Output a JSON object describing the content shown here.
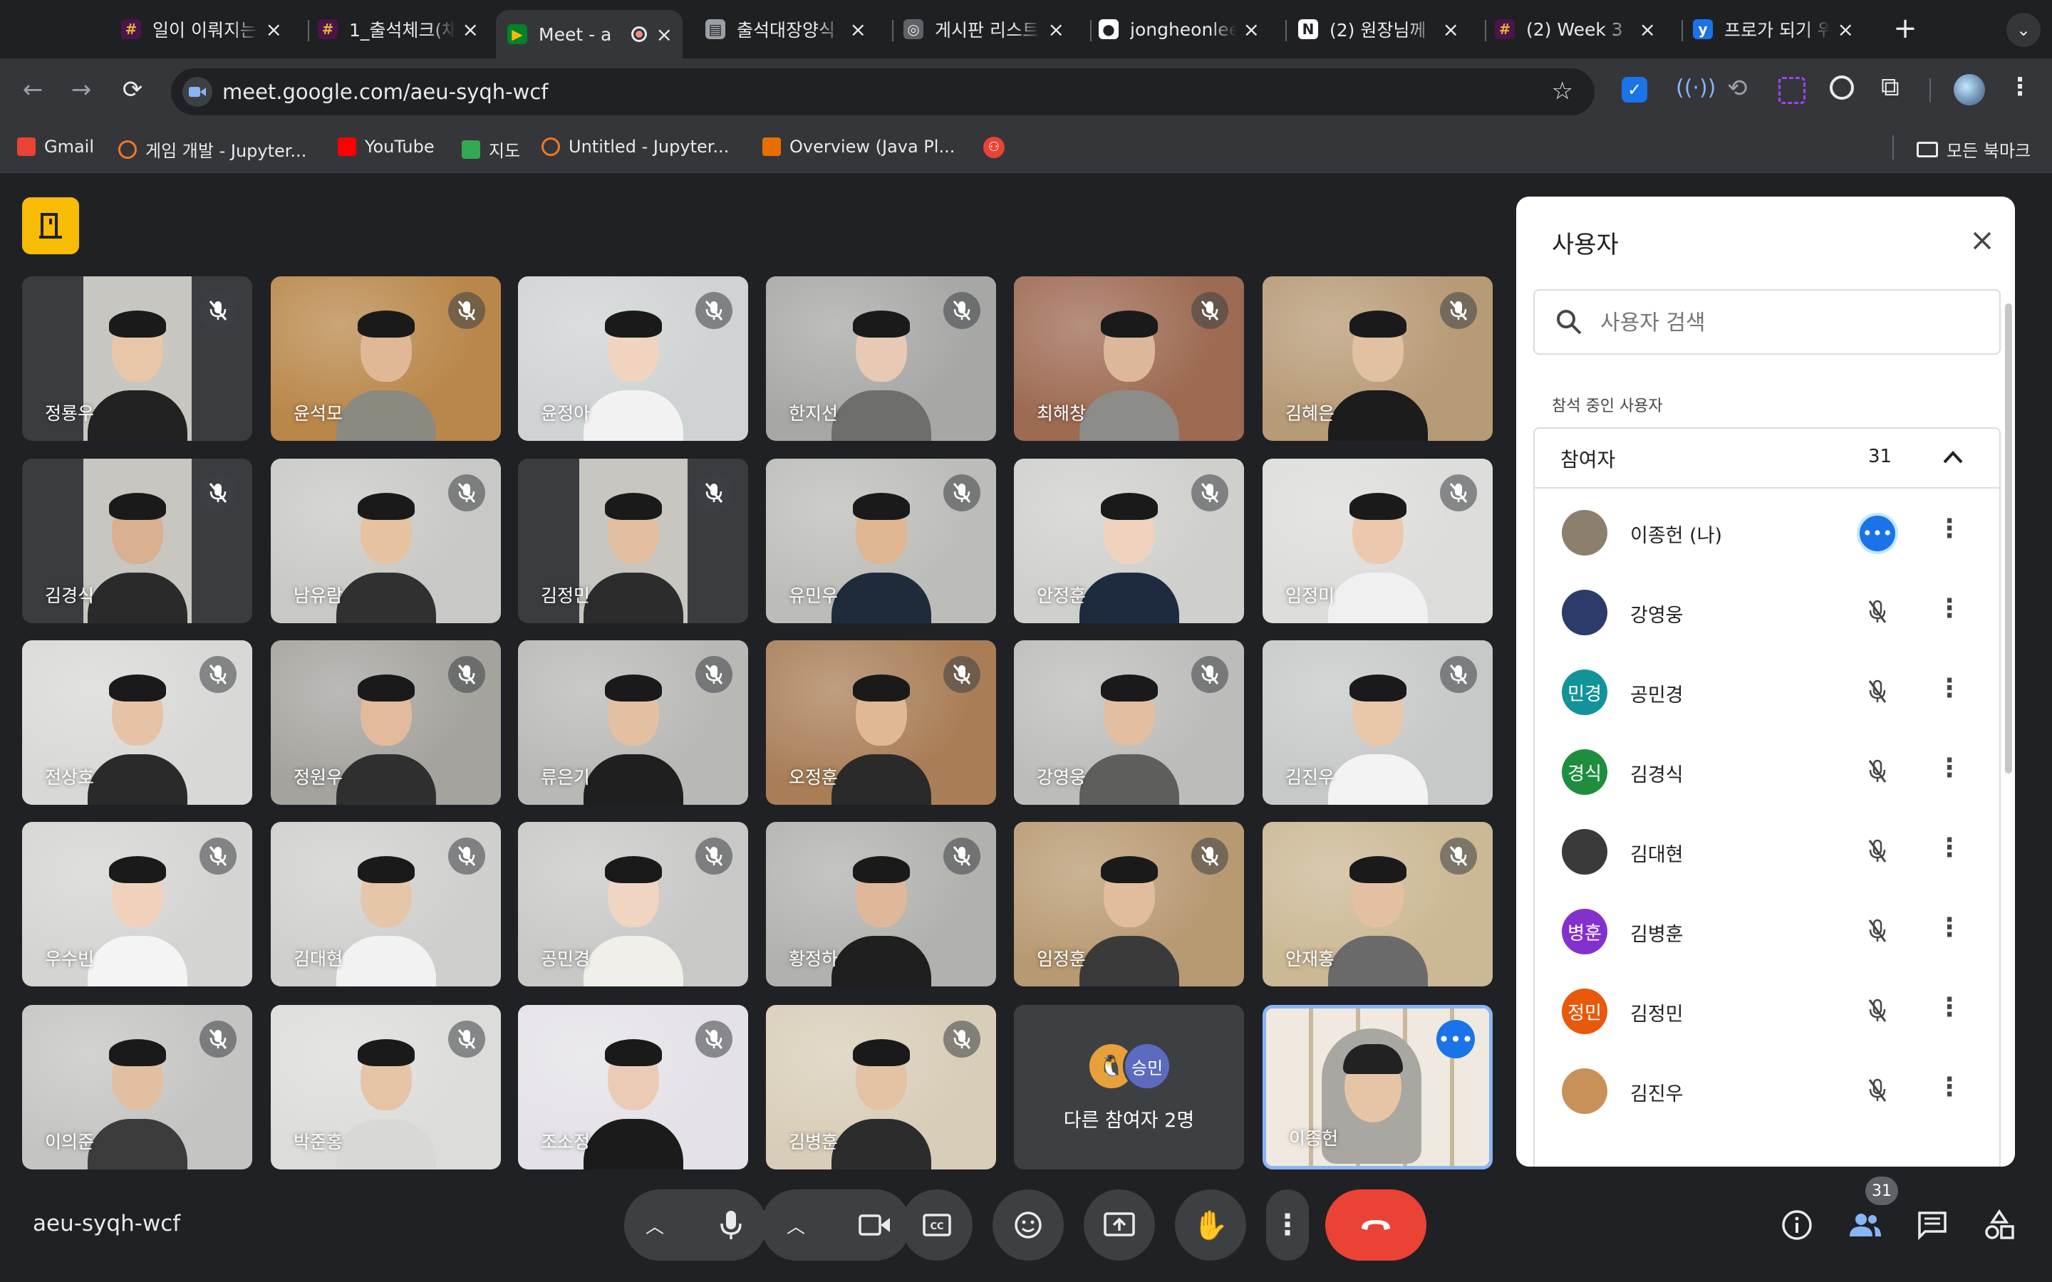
{
  "browser": {
    "tabs": [
      {
        "title": "일이 이뤄지는",
        "icon": "slack-icon"
      },
      {
        "title": "1_출석체크(채",
        "icon": "slack-icon"
      },
      {
        "title": "Meet - a",
        "icon": "meet-icon",
        "active": true
      },
      {
        "title": "출석대장양식",
        "icon": "folder-icon"
      },
      {
        "title": "게시판 리스트",
        "icon": "globe-icon"
      },
      {
        "title": "jongheonlee",
        "icon": "github-icon"
      },
      {
        "title": "(2) 원장님께",
        "icon": "notion-icon"
      },
      {
        "title": "(2) Week 3",
        "icon": "slack-icon"
      },
      {
        "title": "프로가 되기 위",
        "icon": "y-icon"
      }
    ],
    "url": "meet.google.com/aeu-syqh-wcf",
    "bookmarks": [
      {
        "label": "Gmail",
        "icon": "gmail-icon"
      },
      {
        "label": "게임 개발 - Jupyter...",
        "icon": "jupyter-icon"
      },
      {
        "label": "YouTube",
        "icon": "youtube-icon"
      },
      {
        "label": "지도",
        "icon": "maps-icon"
      },
      {
        "label": "Untitled - Jupyter...",
        "icon": "jupyter-icon"
      },
      {
        "label": "Overview (Java Pl...",
        "icon": "java-icon"
      }
    ],
    "all_bookmarks": "모든 북마크"
  },
  "meet": {
    "meeting_code": "aeu-syqh-wcf",
    "participant_count": "31",
    "tiles": [
      {
        "name": "정룡우",
        "bg": "#3a3c40",
        "skin": "#e8c7a8",
        "shirt": "#222222"
      },
      {
        "name": "윤석모",
        "bg": "#b9874a",
        "skin": "#e0b896",
        "shirt": "#8a8a80"
      },
      {
        "name": "윤정아",
        "bg": "#cfd3d4",
        "skin": "#f0d4c0",
        "shirt": "#f2f2f2"
      },
      {
        "name": "한지선",
        "bg": "#a7a8a6",
        "skin": "#e7c9b4",
        "shirt": "#6e6e6a"
      },
      {
        "name": "최해창",
        "bg": "#9d6a52",
        "skin": "#ddb79a",
        "shirt": "#8c8c88"
      },
      {
        "name": "김혜은",
        "bg": "#b79a76",
        "skin": "#e2c1a2",
        "shirt": "#1c1c1c"
      },
      {
        "name": "김경식",
        "bg": "#3a3c40",
        "skin": "#d9b090",
        "shirt": "#2a2a2a"
      },
      {
        "name": "남유람",
        "bg": "#c8c8c6",
        "skin": "#e6c2a0",
        "shirt": "#303030"
      },
      {
        "name": "김정민",
        "bg": "#3a3c40",
        "skin": "#e2bfa0",
        "shirt": "#2c2c2c"
      },
      {
        "name": "유민우",
        "bg": "#bcbcb8",
        "skin": "#dfb592",
        "shirt": "#1f2a3a"
      },
      {
        "name": "안정훈",
        "bg": "#cfcfcc",
        "skin": "#efd3bf",
        "shirt": "#1d2a40"
      },
      {
        "name": "임정미",
        "bg": "#dcdcda",
        "skin": "#ecc9ae",
        "shirt": "#f0f0f0"
      },
      {
        "name": "전상호",
        "bg": "#d8d8d6",
        "skin": "#e6c3a6",
        "shirt": "#2a2a2a"
      },
      {
        "name": "정원우",
        "bg": "#a4a39e",
        "skin": "#e1bb9c",
        "shirt": "#2f2f2f"
      },
      {
        "name": "류은기",
        "bg": "#b8b8b5",
        "skin": "#e4c0a2",
        "shirt": "#1f1f1f"
      },
      {
        "name": "오정훈",
        "bg": "#a97e57",
        "skin": "#e0b894",
        "shirt": "#2a2a2a"
      },
      {
        "name": "강영웅",
        "bg": "#bcbcba",
        "skin": "#e3bea0",
        "shirt": "#5e5e5c"
      },
      {
        "name": "김진우",
        "bg": "#c6c9c8",
        "skin": "#e8c7aa",
        "shirt": "#f3f3f3"
      },
      {
        "name": "우수빈",
        "bg": "#d4d4d2",
        "skin": "#f0d2bc",
        "shirt": "#f4f4f4"
      },
      {
        "name": "김대현",
        "bg": "#cfcfcd",
        "skin": "#e6c6a8",
        "shirt": "#f2f2f2"
      },
      {
        "name": "공민경",
        "bg": "#c8c8c6",
        "skin": "#f0d5c2",
        "shirt": "#f0efe9"
      },
      {
        "name": "황정하",
        "bg": "#b1b1ae",
        "skin": "#dfb89a",
        "shirt": "#1f1f1f"
      },
      {
        "name": "임정훈",
        "bg": "#b89a72",
        "skin": "#e1bd9e",
        "shirt": "#3a3a3a"
      },
      {
        "name": "안재홍",
        "bg": "#cbb894",
        "skin": "#e4c0a2",
        "shirt": "#6a6a6a"
      },
      {
        "name": "이의준",
        "bg": "#c4c4c2",
        "skin": "#e3bfa1",
        "shirt": "#3c3c3c"
      },
      {
        "name": "박준홍",
        "bg": "#dcdcda",
        "skin": "#e6c4a6",
        "shirt": "#d8d8d6"
      },
      {
        "name": "조소정",
        "bg": "#e4e2e8",
        "skin": "#eccbb6",
        "shirt": "#1b1b1b"
      },
      {
        "name": "김병훈",
        "bg": "#d8cdb8",
        "skin": "#e4c2a4",
        "shirt": "#2c2c2c"
      }
    ],
    "others_tile": {
      "label": "다른 참여자 2명",
      "avatar_label": "승민"
    },
    "self_tile": {
      "name": "이종헌"
    },
    "panel": {
      "title": "사용자",
      "search_placeholder": "사용자 검색",
      "section_label": "참석 중인 사용자",
      "group_label": "참여자",
      "group_count": "31",
      "people": [
        {
          "name": "이종헌 (나)",
          "avatar": "",
          "color": "#8d7f6e"
        },
        {
          "name": "강영웅",
          "avatar": "",
          "color": "#2d3b6b"
        },
        {
          "name": "공민경",
          "avatar": "민경",
          "color": "#12939a"
        },
        {
          "name": "김경식",
          "avatar": "경식",
          "color": "#1e8e3e"
        },
        {
          "name": "김대현",
          "avatar": "",
          "color": "#3a3a3a"
        },
        {
          "name": "김병훈",
          "avatar": "병훈",
          "color": "#8430ce"
        },
        {
          "name": "김정민",
          "avatar": "정민",
          "color": "#e8590c"
        },
        {
          "name": "김진우",
          "avatar": "",
          "color": "#c8915a"
        }
      ]
    }
  }
}
